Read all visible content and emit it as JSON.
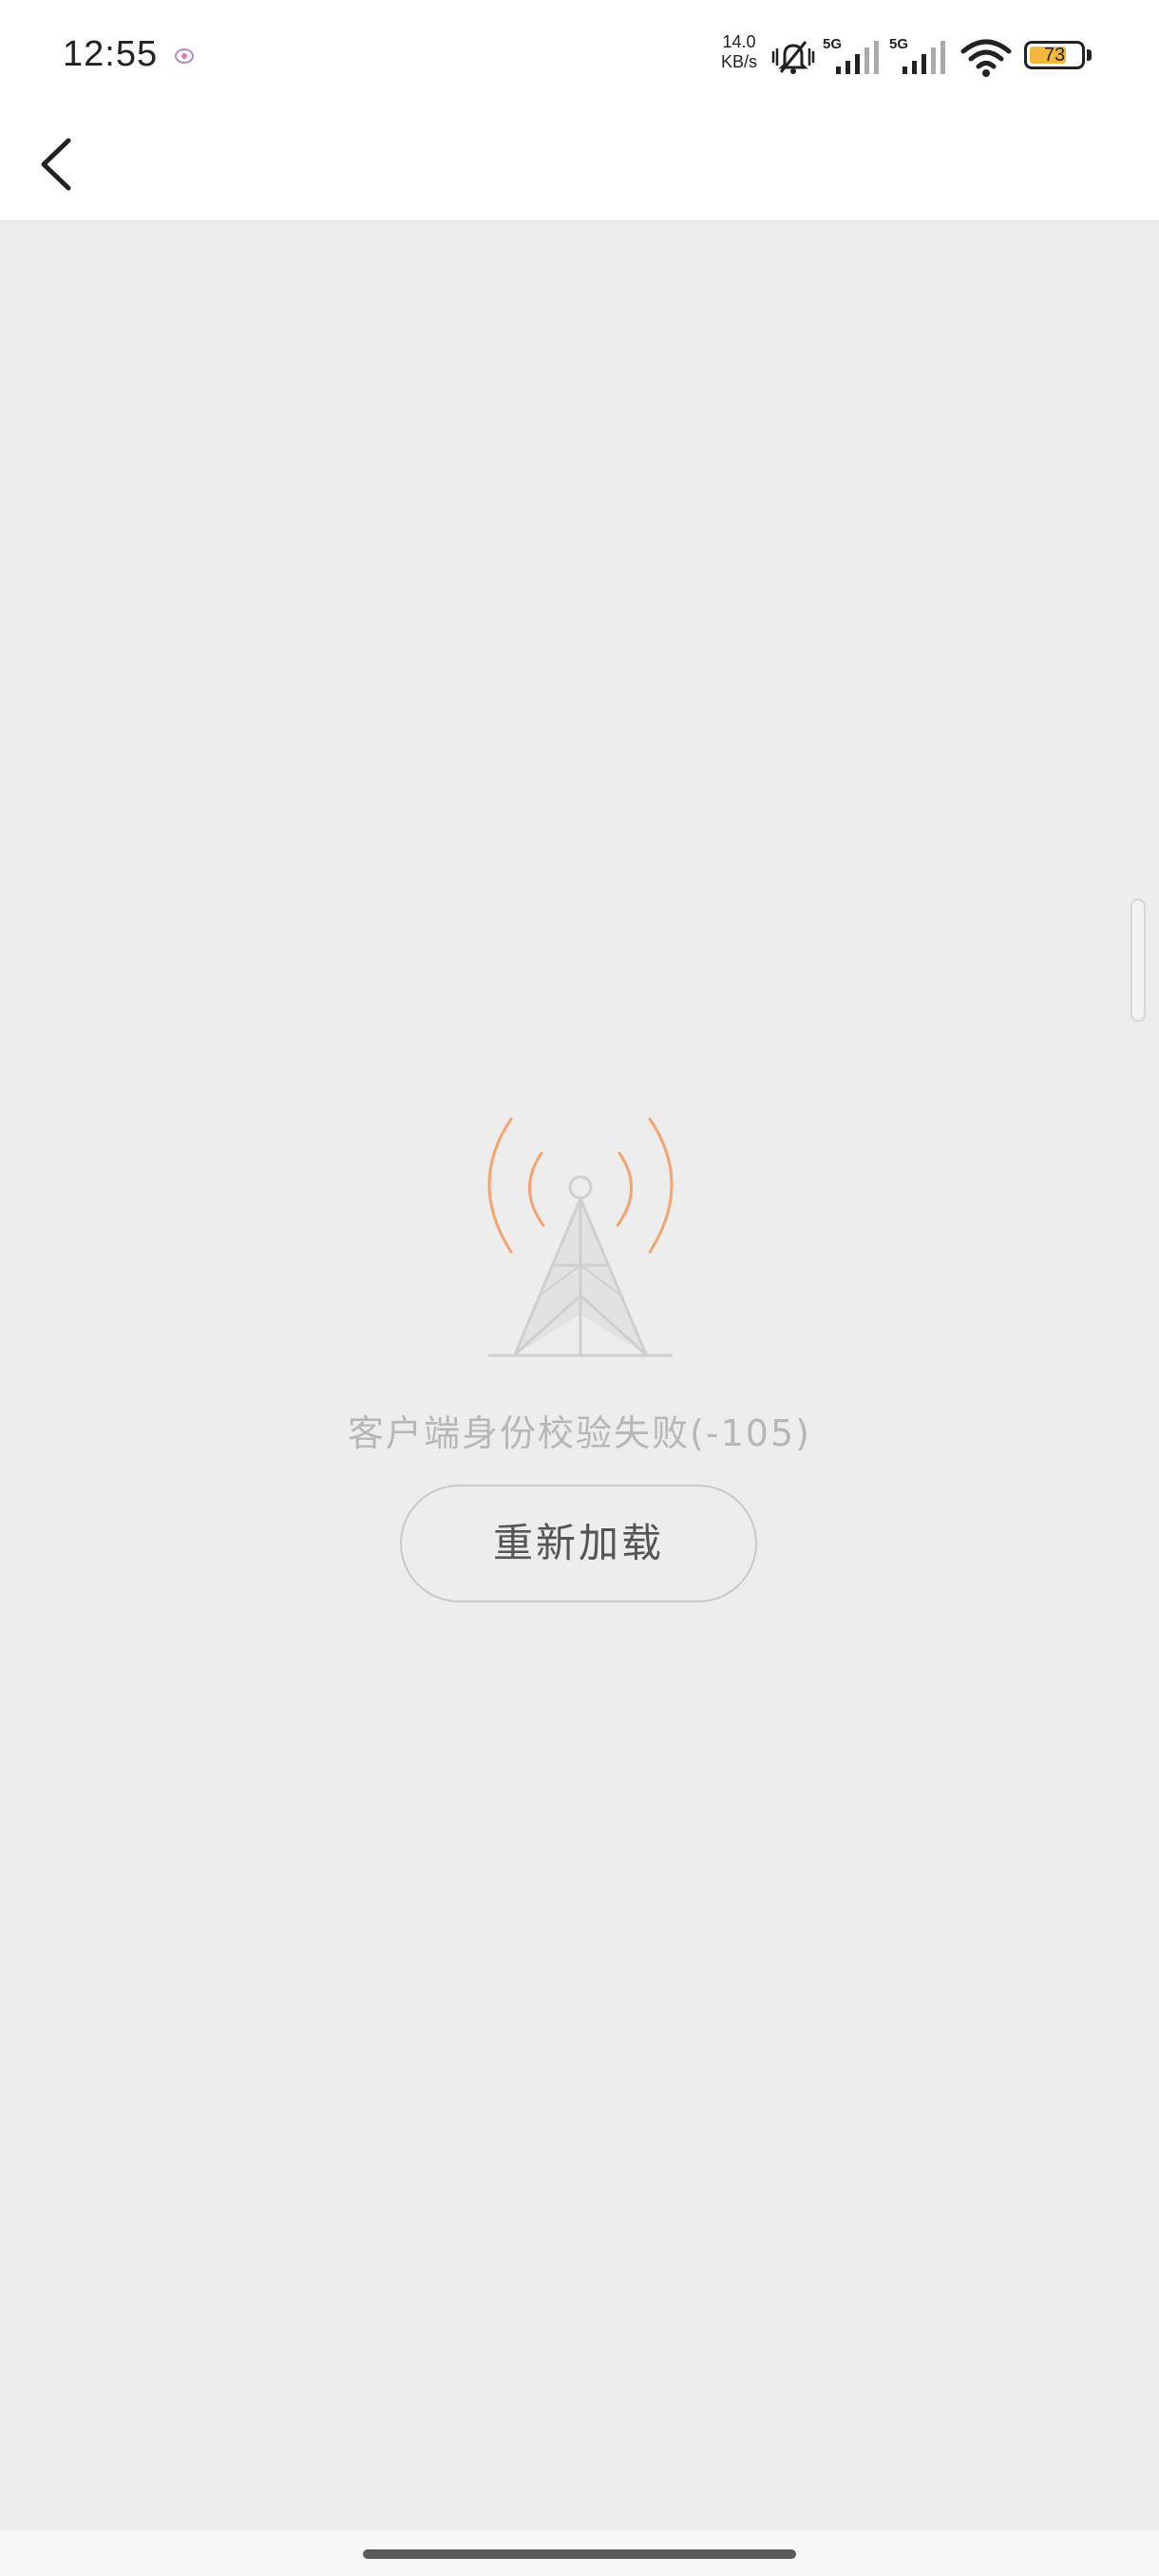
{
  "status_bar": {
    "time": "12:55",
    "net_speed_value": "14.0",
    "net_speed_unit": "KB/s",
    "sim1_label": "5G",
    "sim2_label": "5G",
    "battery_level": 73,
    "battery_text": "73",
    "battery_color": "#f4b73b",
    "icons": [
      "app-notification-icon",
      "bell-muted-icon",
      "signal-icon",
      "signal-icon",
      "wifi-icon",
      "battery-icon"
    ]
  },
  "nav": {
    "back_icon": "chevron-left-icon"
  },
  "main": {
    "illustration": "signal-tower-icon",
    "accent_color": "#f5a36f",
    "error_message": "客户端身份校验失败(-105)",
    "reload_label": "重新加载"
  }
}
